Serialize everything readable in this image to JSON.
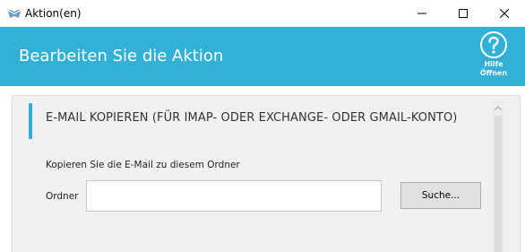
{
  "window": {
    "title": "Aktion(en)"
  },
  "header": {
    "title": "Bearbeiten Sie die Aktion",
    "help_label_line1": "Hilfe",
    "help_label_line2": "Öffnen"
  },
  "section": {
    "title": "E-MAIL KOPIEREN (FÜR IMAP- ODER EXCHANGE- ODER GMAIL-KONTO)",
    "instruction": "Kopieren Sie die E-Mail zu diesem Ordner",
    "folder_label": "Ordner",
    "folder_value": "",
    "search_button": "Suche..."
  },
  "colors": {
    "accent": "#33b0d6",
    "panel_background": "#f1f1f1"
  },
  "icons": {
    "app": "app-logo-icon",
    "minimize": "minimize-icon",
    "maximize": "maximize-icon",
    "close": "close-icon",
    "help": "help-circle-icon",
    "scroll_up": "scroll-up-arrow-icon"
  }
}
